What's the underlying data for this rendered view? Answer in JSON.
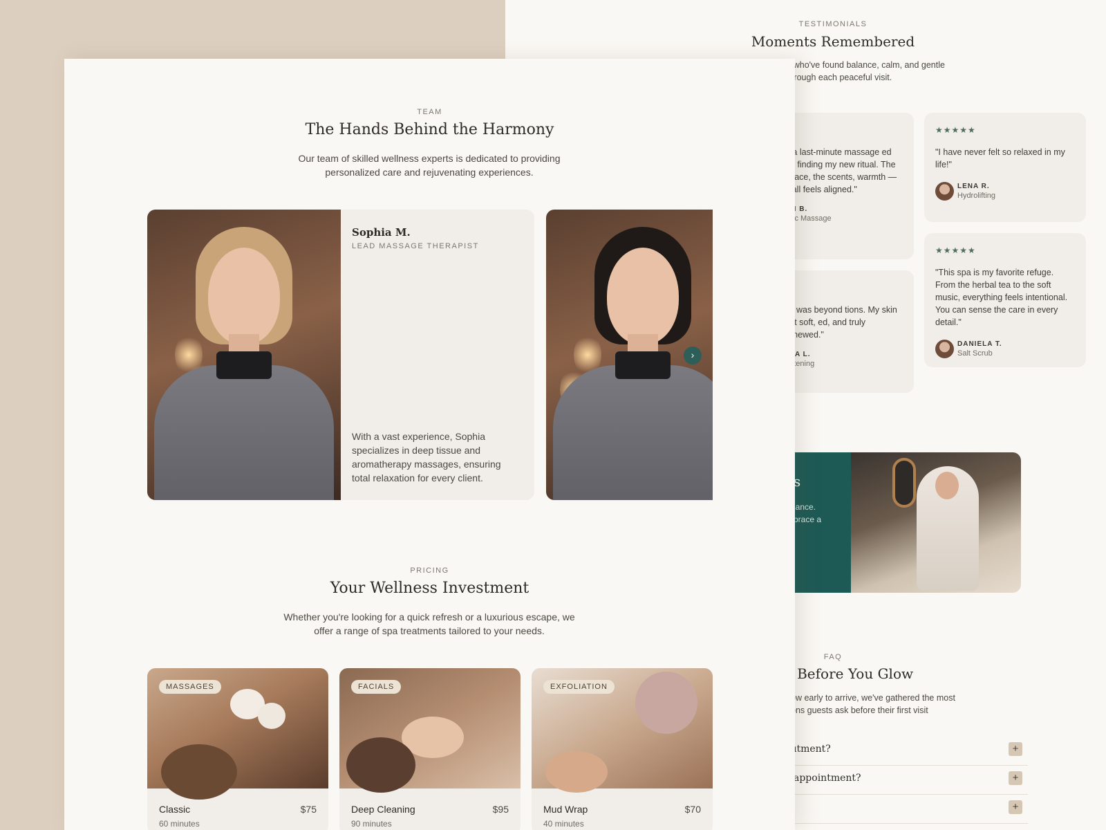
{
  "testimonials": {
    "eyebrow": "TESTIMONIALS",
    "title": "Moments Remembered",
    "desc_line1": "s who've found balance, calm, and gentle",
    "desc_line2": "through each peaceful visit.",
    "cards": [
      {
        "stars": "★",
        "quote": "d a last-minute massage ed up finding my new ritual. The space, the scents, warmth — it all feels aligned.\"",
        "name": "HN B.",
        "service": "ssic Massage"
      },
      {
        "stars": "★",
        "quote": "ial was beyond tions. My skin felt soft, ed, and truly renewed.\"",
        "name": "AYA L.",
        "service": "ghtening"
      },
      {
        "stars": "★★★★★",
        "quote": "\"I have never felt so relaxed in my life!\"",
        "name": "LENA R.",
        "service": "Hydrolifting"
      },
      {
        "stars": "★★★★★",
        "quote": "\"This spa is my favorite refuge. From the herbal tea to the soft music, everything feels intentional. You can sense the care in every detail.\"",
        "name": "DANIELA T.",
        "service": "Salt Scrub"
      }
    ]
  },
  "banner": {
    "title_fragment": "s",
    "text_line1": "lance.",
    "text_line2": "brace a"
  },
  "faq": {
    "eyebrow": "FAQ",
    "title": "/ Before You Glow",
    "desc_line1": "ow early to arrive, we've gathered the most",
    "desc_line2": "ons guests ask before their first visit",
    "items": [
      {
        "question": "ıtment?",
        "toggle": "+"
      },
      {
        "question": "appointment?",
        "toggle": "+"
      },
      {
        "question": "",
        "toggle": "+"
      }
    ]
  },
  "team": {
    "eyebrow": "TEAM",
    "title": "The Hands Behind the Harmony",
    "desc_line1": "Our team of skilled wellness experts is dedicated to providing",
    "desc_line2": "personalized care and rejuvenating experiences.",
    "member": {
      "name": "Sophia M.",
      "role": "LEAD MASSAGE THERAPIST",
      "bio": "With a vast experience, Sophia specializes in deep tissue and aromatherapy massages, ensuring total relaxation for every client."
    },
    "next_icon": "›"
  },
  "pricing": {
    "eyebrow": "PRICING",
    "title": "Your Wellness Investment",
    "desc_line1": "Whether you're looking for a quick refresh or a luxurious escape, we",
    "desc_line2": "offer a range of spa treatments tailored to your needs.",
    "cards": [
      {
        "tag": "MASSAGES",
        "name": "Classic",
        "price": "$75",
        "duration": "60 minutes"
      },
      {
        "tag": "FACIALS",
        "name": "Deep Cleaning",
        "price": "$95",
        "duration": "90 minutes"
      },
      {
        "tag": "EXFOLIATION",
        "name": "Mud Wrap",
        "price": "$70",
        "duration": "40 minutes"
      }
    ]
  },
  "colors": {
    "tan_background": "#ddcfbf",
    "page": "#faf8f4",
    "card": "#f1eeea",
    "accent_green": "#1e5a55",
    "star_green": "#4d6e5f",
    "plus_button": "#d6c7b5"
  }
}
